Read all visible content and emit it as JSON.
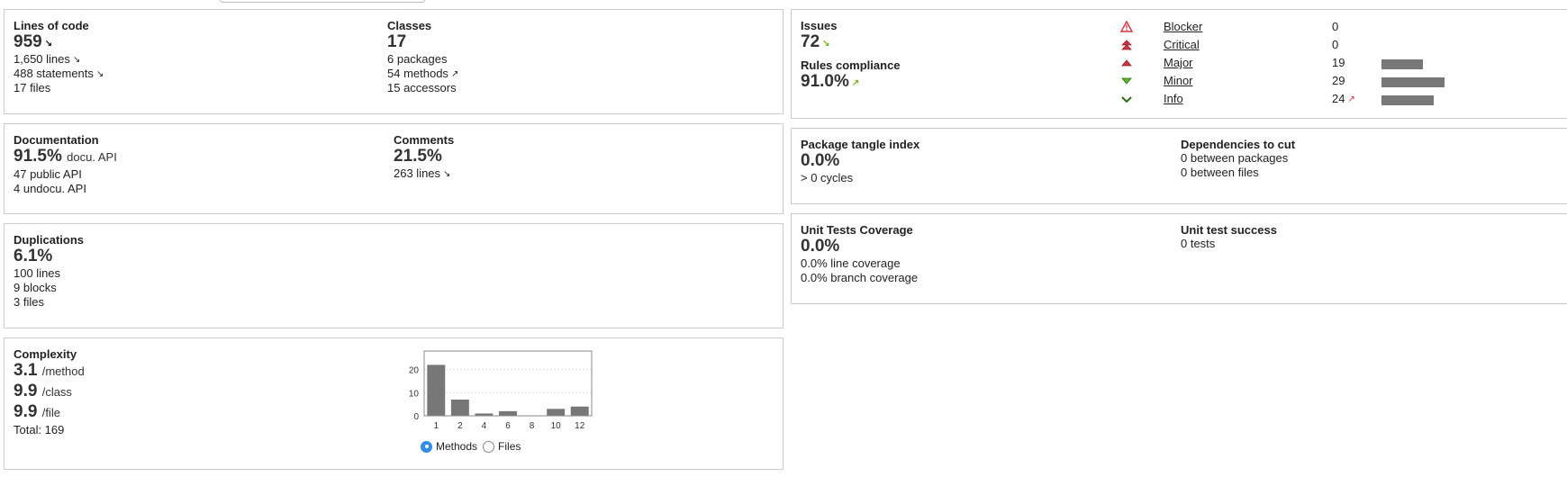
{
  "loc": {
    "title": "Lines of code",
    "value": "959",
    "lines": "1,650 lines",
    "statements": "488 statements",
    "files": "17 files"
  },
  "classes": {
    "title": "Classes",
    "value": "17",
    "packages": "6 packages",
    "methods": "54 methods",
    "accessors": "15 accessors"
  },
  "documentation": {
    "title": "Documentation",
    "value": "91.5%",
    "unit": "docu. API",
    "public_api": "47 public API",
    "undocu_api": "4 undocu. API"
  },
  "comments": {
    "title": "Comments",
    "value": "21.5%",
    "lines": "263 lines"
  },
  "duplications": {
    "title": "Duplications",
    "value": "6.1%",
    "lines": "100 lines",
    "blocks": "9 blocks",
    "files": "3 files"
  },
  "complexity": {
    "title": "Complexity",
    "per_method": "3.1",
    "per_method_unit": "/method",
    "per_class": "9.9",
    "per_class_unit": "/class",
    "per_file": "9.9",
    "per_file_unit": "/file",
    "total": "Total: 169",
    "radio_methods": "Methods",
    "radio_files": "Files",
    "selected": "Methods"
  },
  "chart_data": {
    "type": "bar",
    "categories": [
      "1",
      "2",
      "4",
      "6",
      "8",
      "10",
      "12"
    ],
    "values": [
      22,
      7,
      1,
      2,
      0,
      3,
      4
    ],
    "ylim": [
      0,
      28
    ],
    "yticks": [
      0,
      10,
      20
    ],
    "grid": true,
    "bar_color": "#777777"
  },
  "issues": {
    "title": "Issues",
    "value": "72",
    "rules_title": "Rules compliance",
    "rules_value": "91.0%",
    "severities": [
      {
        "name": "Blocker",
        "count": "0",
        "ratio": 0,
        "icon": "blocker-icon"
      },
      {
        "name": "Critical",
        "count": "0",
        "ratio": 0,
        "icon": "critical-icon"
      },
      {
        "name": "Major",
        "count": "19",
        "ratio": 0.655,
        "icon": "major-icon"
      },
      {
        "name": "Minor",
        "count": "29",
        "ratio": 1.0,
        "icon": "minor-icon"
      },
      {
        "name": "Info",
        "count": "24",
        "ratio": 0.828,
        "icon": "info-icon"
      }
    ]
  },
  "tangle": {
    "title": "Package tangle index",
    "value": "0.0%",
    "cycles": "> 0 cycles",
    "deps_title": "Dependencies to cut",
    "between_packages": "0 between packages",
    "between_files": "0 between files"
  },
  "coverage": {
    "title": "Unit Tests Coverage",
    "value": "0.0%",
    "line_coverage": "0.0% line coverage",
    "branch_coverage": "0.0% branch coverage",
    "success_title": "Unit test success",
    "tests": "0 tests"
  },
  "colors": {
    "up_good": "#7ab317",
    "up_bad": "#d4333f",
    "border": "#cccccc",
    "radio_selected": "#2f8de4"
  }
}
